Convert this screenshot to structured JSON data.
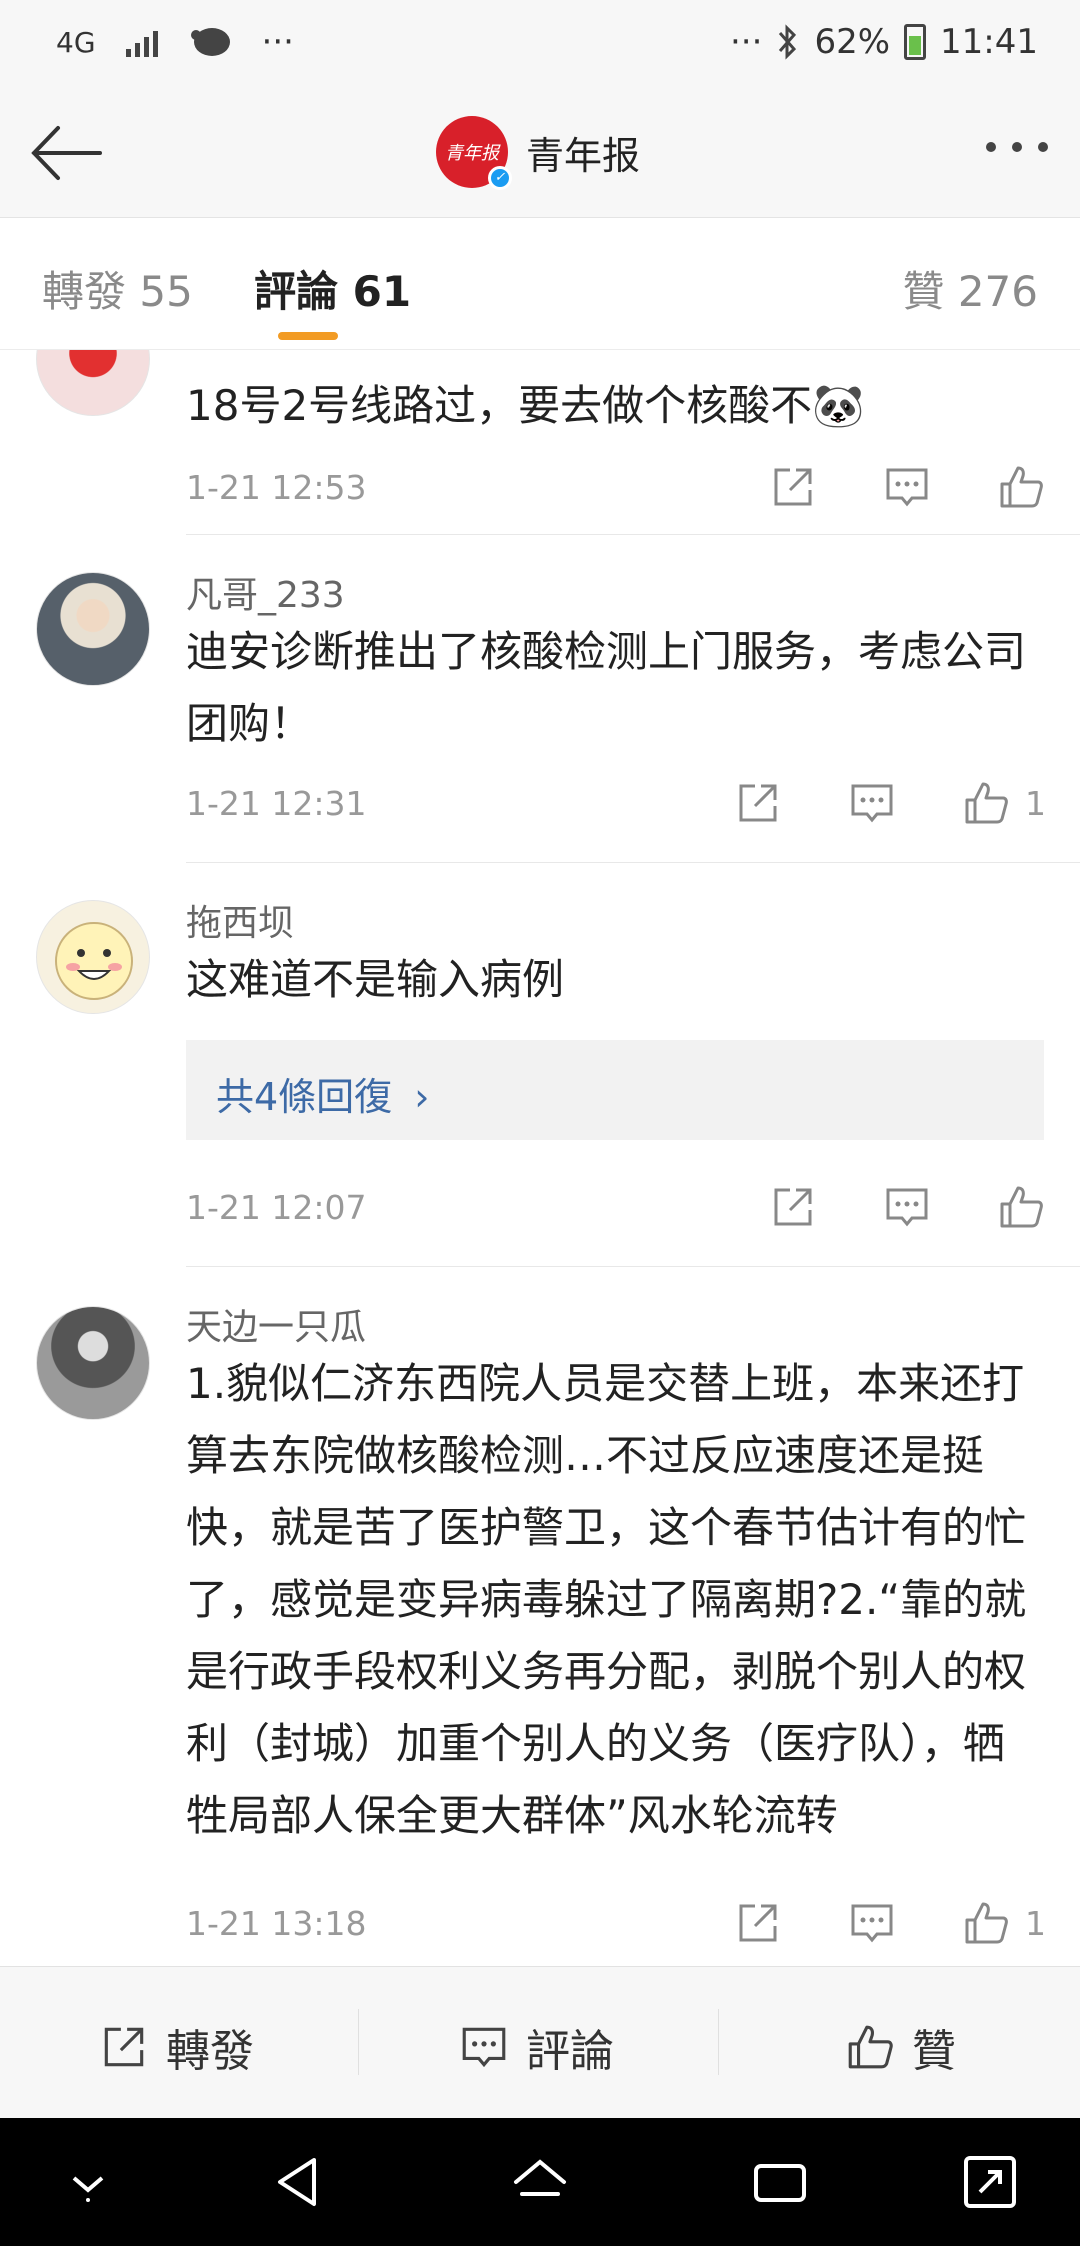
{
  "status_bar": {
    "network": "4G",
    "dots": "···",
    "right_dots": "···",
    "battery": "62%",
    "time": "11:41"
  },
  "header": {
    "title": "青年报",
    "logo_text": "青年报"
  },
  "tabs": {
    "repost": "轉發 55",
    "comments": "評論 61",
    "likes": "贊 276"
  },
  "comments": [
    {
      "username": "",
      "text": "18号2号线路过，要去做个核酸不🐼",
      "time": "1-21 12:53",
      "likes": ""
    },
    {
      "username": "凡哥_233",
      "text": "迪安诊断推出了核酸检测上门服务，考虑公司团购！",
      "time": "1-21 12:31",
      "likes": "1"
    },
    {
      "username": "拖西坝",
      "text": "这难道不是输入病例",
      "reply_summary": "共4條回復",
      "time": "1-21 12:07",
      "likes": ""
    },
    {
      "username": "天边一只瓜",
      "text": "1.貌似仁济东西院人员是交替上班，本来还打算去东院做核酸检测…不过反应速度还是挺快，就是苦了医护警卫，这个春节估计有的忙了，感觉是变异病毒躲过了隔离期?2.“靠的就是行政手段权利义务再分配，剥脱个别人的权利（封城）加重个别人的义务（医疗队），牺牲局部人保全更大群体”风水轮流转",
      "time": "1-21 13:18",
      "likes": "1"
    }
  ],
  "bottom_bar": {
    "repost": "轉發",
    "comment": "評論",
    "like": "贊"
  },
  "colors": {
    "accent": "#f29b24",
    "link": "#3d6aa6",
    "logo_red": "#d8202a",
    "verified_blue": "#1b9cf2"
  }
}
